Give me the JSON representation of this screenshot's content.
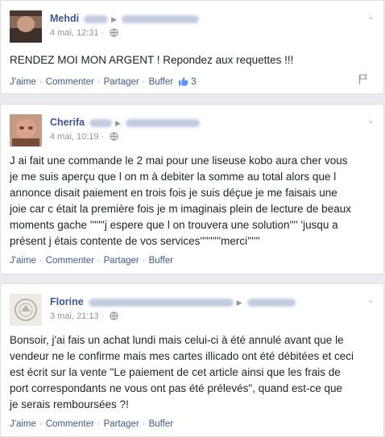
{
  "posts": [
    {
      "author": "Mehdi",
      "time": "4 mai, 12:31",
      "text": "RENDEZ MOI MON ARGENT ! Repondez aux requettes !!!",
      "likes": "3"
    },
    {
      "author": "Cherifa",
      "time": "4 mai, 10:19",
      "text": "J ai fait une commande le 2 mai pour une liseuse kobo aura cher vous\nje me suis aperçu que l on m à debiter la somme au total alors que l\nannonce disait paiement en trois fois je suis déçue je me faisais une\njoie car c était la première fois je m imaginais plein de lecture de beaux\nmoments gache '''''''j espere que l on trouvera une solution'''' 'jusqu a\nprésent j étais contente de vos services''''''''''merci''''''"
    },
    {
      "author": "Florine",
      "time": "3 mai, 21:13",
      "text": "Bonsoir, j'ai fais un achat lundi mais celui-ci à été annulé avant que le\nvendeur ne le confirme mais mes cartes illicado ont été débitées et ceci\nest écrit sur la vente \"Le paiement de cet article ainsi que les frais de\nport correspondants ne vous ont pas été prélevés\", quand est-ce que\nje serais remboursées ?!"
    }
  ],
  "actions": {
    "like": "J'aime",
    "comment": "Commenter",
    "share": "Partager",
    "buffer": "Buffer"
  },
  "colors": {
    "link": "#3b5998",
    "meta": "#90949c",
    "background": "#e9ebee"
  }
}
